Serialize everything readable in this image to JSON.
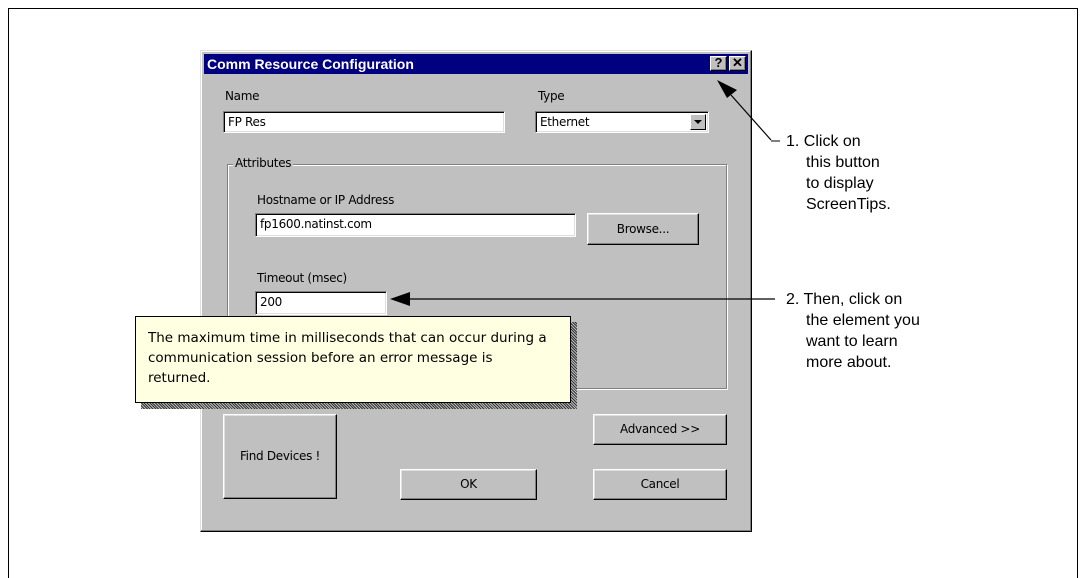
{
  "dialog": {
    "title": "Comm Resource Configuration",
    "help_button": "?",
    "close_button": "✕",
    "name_label": "Name",
    "name_value": "FP Res",
    "type_label": "Type",
    "type_value": "Ethernet",
    "attributes_label": "Attributes",
    "hostname_label": "Hostname or IP Address",
    "hostname_value": "fp1600.natinst.com",
    "browse_button": "Browse...",
    "timeout_label": "Timeout (msec)",
    "timeout_value": "200",
    "advanced_button": "Advanced  >>",
    "find_devices_button": "Find Devices !",
    "ok_button": "OK",
    "cancel_button": "Cancel"
  },
  "tooltip": {
    "text": "The maximum time in milliseconds that can occur during a communication session before an error message is returned."
  },
  "callouts": {
    "step1": [
      "1. Click on",
      "this button",
      "to display",
      "ScreenTips."
    ],
    "step2": [
      "2. Then, click on",
      "the element you",
      "want to learn",
      "more about."
    ]
  }
}
